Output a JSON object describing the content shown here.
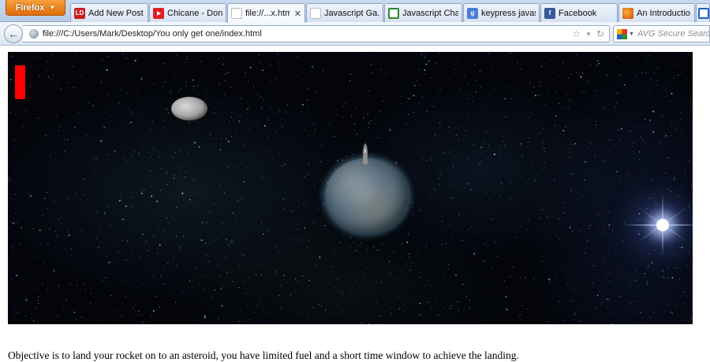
{
  "browser": {
    "menu_button": "Firefox",
    "tabs": [
      {
        "label": "Add New Post ...",
        "icon": "ld-favicon-icon",
        "active": false
      },
      {
        "label": "Chicane - Don...",
        "icon": "youtube-icon",
        "active": false
      },
      {
        "label": "file://...x.html",
        "icon": "blank-page-icon",
        "active": true
      },
      {
        "label": "Javascript Ga...",
        "icon": "blank-page-icon",
        "active": false
      },
      {
        "label": "Javascript Cha...",
        "icon": "gear-icon",
        "active": false
      },
      {
        "label": "keypress javas...",
        "icon": "google-icon",
        "active": false
      },
      {
        "label": "Facebook",
        "icon": "facebook-icon",
        "active": false
      },
      {
        "label": "An Introductio...",
        "icon": "firefox-icon",
        "active": false
      }
    ],
    "address": "file:///C:/Users/Mark/Desktop/You only get one/index.html",
    "search_placeholder": "AVG Secure Search"
  },
  "page": {
    "instructions": "Objective is to land your rocket on to an asteroid, you have limited fuel and a short time window to achieve the landing."
  },
  "colors": {
    "fuel_bar": "#ff0000",
    "space_background": "#03050b"
  }
}
